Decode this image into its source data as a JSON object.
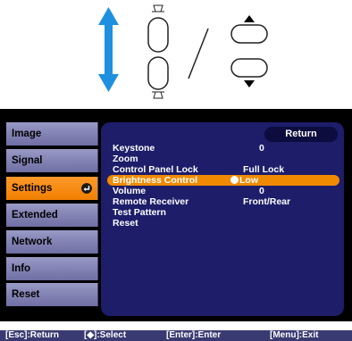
{
  "top_menu": {
    "items": [
      {
        "label": "Image"
      },
      {
        "label": "Signal"
      },
      {
        "label": "Settings",
        "active": true
      },
      {
        "label": "Extended"
      },
      {
        "label": "Network"
      },
      {
        "label": "Info"
      },
      {
        "label": "Reset"
      }
    ]
  },
  "sub_menu": {
    "return_label": "Return",
    "items": [
      {
        "label": "Keystone",
        "value": "0"
      },
      {
        "label": "Zoom",
        "value": ""
      },
      {
        "label": "Control Panel Lock",
        "value": "Full Lock"
      },
      {
        "label": "Brightness Control",
        "value": "Low",
        "active": true
      },
      {
        "label": "Volume",
        "value": "0"
      },
      {
        "label": "Remote Receiver",
        "value": "Front/Rear"
      },
      {
        "label": "Test Pattern",
        "value": ""
      },
      {
        "label": "Reset",
        "value": ""
      }
    ]
  },
  "footer": {
    "esc": "[Esc]:Return",
    "select": "[◆]:Select",
    "enter": "[Enter]:Enter",
    "menu": "[Menu]:Exit"
  },
  "colors": {
    "arrow": "#1e90e0",
    "active": "#f08000",
    "panel": "#1d1d6a"
  },
  "icons": [
    "up-down-arrow-icon",
    "keystone-buttons-icon",
    "slash-divider-icon",
    "up-down-buttons-icon",
    "enter-icon"
  ]
}
